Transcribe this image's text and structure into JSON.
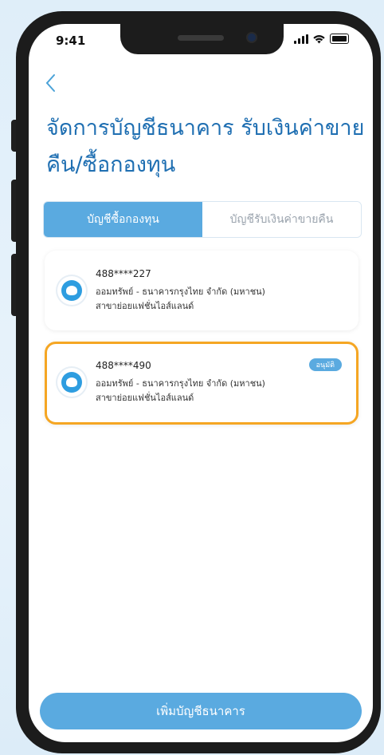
{
  "status_bar": {
    "time": "9:41"
  },
  "header": {
    "title": "จัดการบัญชีธนาคาร รับเงินค่าขายคืน/ซื้อกองทุน"
  },
  "tabs": [
    {
      "label": "บัญชีซื้อกองทุน",
      "active": true
    },
    {
      "label": "บัญชีรับเงินค่าขายคืน",
      "active": false
    }
  ],
  "accounts": [
    {
      "number": "488****227",
      "type_bank": "ออมทรัพย์ - ธนาคารกรุงไทย จำกัด (มหาชน)",
      "branch": "สาขาย่อยแฟชั่นไอส์แลนด์",
      "badge": ""
    },
    {
      "number": "488****490",
      "type_bank": "ออมทรัพย์ - ธนาคารกรุงไทย จำกัด (มหาชน)",
      "branch": "สาขาย่อยแฟชั่นไอส์แลนด์",
      "badge": "อนุมัติ"
    }
  ],
  "actions": {
    "add_label": "เพิ่มบัญชีธนาคาร"
  },
  "colors": {
    "accent": "#5aaae0",
    "title": "#1f6fb2",
    "highlight": "#f5a623"
  },
  "icons": {
    "back": "chevron-left-icon",
    "bank": "krungthai-bank-logo-icon"
  }
}
